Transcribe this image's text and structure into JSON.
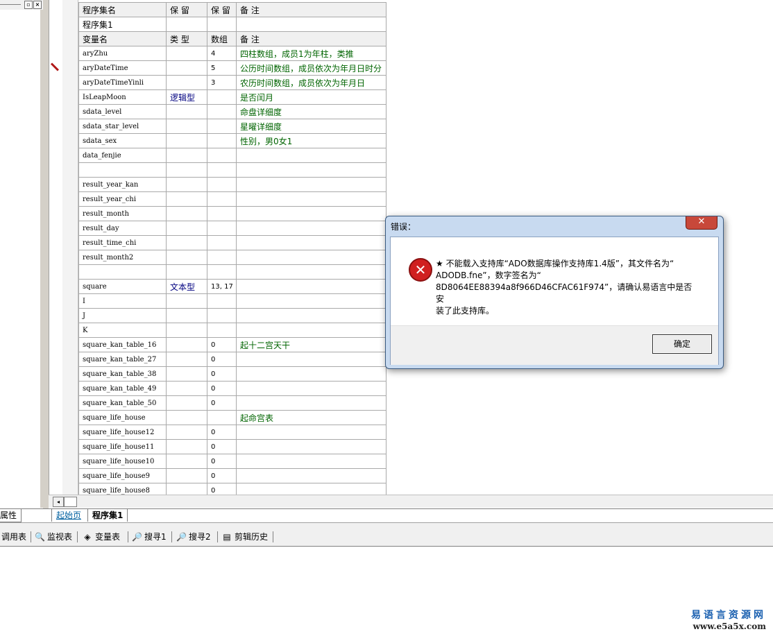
{
  "left_panel": {
    "props_tab": "属性"
  },
  "table_headers": {
    "assembly": [
      "程序集名",
      "保 留",
      "保 留",
      "备 注"
    ],
    "vars": [
      "变量名",
      "类 型",
      "数组",
      "备 注"
    ]
  },
  "assembly_name": "程序集1",
  "variables": [
    {
      "name": "aryZhu",
      "type": "",
      "dim": "4",
      "note": "四柱数组，成员1为年柱，类推"
    },
    {
      "name": "aryDateTime",
      "type": "",
      "dim": "5",
      "note": "公历时间数组，成员依次为年月日时分"
    },
    {
      "name": "aryDateTimeYinli",
      "type": "",
      "dim": "3",
      "note": "农历时间数组，成员依次为年月日"
    },
    {
      "name": "IsLeapMoon",
      "type": "逻辑型",
      "dim": "",
      "note": "是否闰月"
    },
    {
      "name": "sdata_level",
      "type": "",
      "dim": "",
      "note": "命盘详细度"
    },
    {
      "name": "sdata_star_level",
      "type": "",
      "dim": "",
      "note": "星曜详细度"
    },
    {
      "name": "sdata_sex",
      "type": "",
      "dim": "",
      "note": "性别，男0女1"
    },
    {
      "name": "data_fenjie",
      "type": "",
      "dim": "",
      "note": ""
    },
    {
      "name": "",
      "type": "",
      "dim": "",
      "note": ""
    },
    {
      "name": "result_year_kan",
      "type": "",
      "dim": "",
      "note": ""
    },
    {
      "name": "result_year_chi",
      "type": "",
      "dim": "",
      "note": ""
    },
    {
      "name": "result_month",
      "type": "",
      "dim": "",
      "note": ""
    },
    {
      "name": "result_day",
      "type": "",
      "dim": "",
      "note": ""
    },
    {
      "name": "result_time_chi",
      "type": "",
      "dim": "",
      "note": ""
    },
    {
      "name": "result_month2",
      "type": "",
      "dim": "",
      "note": ""
    },
    {
      "name": "",
      "type": "",
      "dim": "",
      "note": ""
    },
    {
      "name": "square",
      "type": "文本型",
      "dim": "13, 17",
      "note": ""
    },
    {
      "name": "I",
      "type": "",
      "dim": "",
      "note": ""
    },
    {
      "name": "J",
      "type": "",
      "dim": "",
      "note": ""
    },
    {
      "name": "K",
      "type": "",
      "dim": "",
      "note": ""
    },
    {
      "name": "square_kan_table_16",
      "type": "",
      "dim": "0",
      "note": "起十二宫天干"
    },
    {
      "name": "square_kan_table_27",
      "type": "",
      "dim": "0",
      "note": ""
    },
    {
      "name": "square_kan_table_38",
      "type": "",
      "dim": "0",
      "note": ""
    },
    {
      "name": "square_kan_table_49",
      "type": "",
      "dim": "0",
      "note": ""
    },
    {
      "name": "square_kan_table_50",
      "type": "",
      "dim": "0",
      "note": ""
    },
    {
      "name": "square_life_house",
      "type": "",
      "dim": "",
      "note": "起命宫表"
    },
    {
      "name": "square_life_house12",
      "type": "",
      "dim": "0",
      "note": ""
    },
    {
      "name": "square_life_house11",
      "type": "",
      "dim": "0",
      "note": ""
    },
    {
      "name": "square_life_house10",
      "type": "",
      "dim": "0",
      "note": ""
    },
    {
      "name": "square_life_house9",
      "type": "",
      "dim": "0",
      "note": ""
    },
    {
      "name": "square_life_house8",
      "type": "",
      "dim": "0",
      "note": ""
    }
  ],
  "tabs": {
    "start": "起始页",
    "active": "程序集1"
  },
  "toolbar": [
    {
      "label": "调用表",
      "icon": "call-table-icon",
      "glyph": ""
    },
    {
      "label": "监视表",
      "icon": "magnifier-icon",
      "glyph": "🔍"
    },
    {
      "label": "变量表",
      "icon": "variables-icon",
      "glyph": "◈"
    },
    {
      "label": "搜寻1",
      "icon": "search1-icon",
      "glyph": "🔎"
    },
    {
      "label": "搜寻2",
      "icon": "search2-icon",
      "glyph": "🔎"
    },
    {
      "label": "剪辑历史",
      "icon": "clip-history-icon",
      "glyph": "▤"
    }
  ],
  "dialog": {
    "title": "错误：",
    "close": "✕",
    "message": "★ 不能载入支持库“ADO数据库操作支持库1.4版”，其文件名为“\nADODB.fne”，数字签名为“\n8D8064EE88394a8f966D46CFAC61F974”，请确认易语言中是否安\n装了此支持库。",
    "ok_label": "确定"
  },
  "watermark": {
    "cn": "易语言资源网",
    "url": "www.e5a5x.com"
  }
}
